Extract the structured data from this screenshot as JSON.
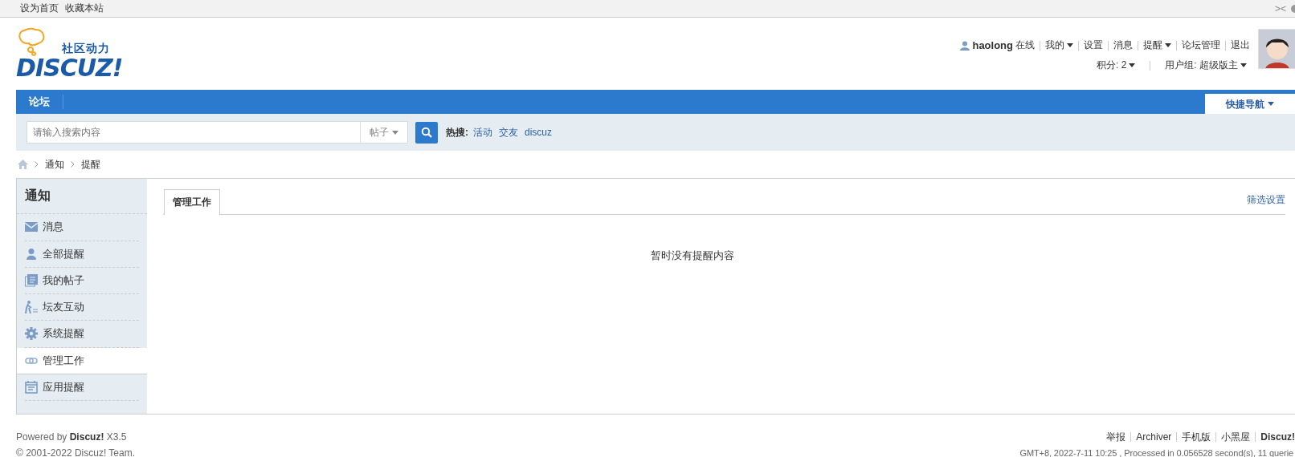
{
  "top_bar": {
    "links": [
      "设为首页",
      "收藏本站"
    ],
    "control": "><"
  },
  "logo": {
    "tagline": "社区动力",
    "brand": "DISCUZ!"
  },
  "user_menu": {
    "username": "haolong",
    "status": "在线",
    "links": [
      {
        "label": "我的",
        "dropdown": true
      },
      {
        "label": "设置",
        "dropdown": false
      },
      {
        "label": "消息",
        "dropdown": false
      },
      {
        "label": "提醒",
        "dropdown": true
      },
      {
        "label": "论坛管理",
        "dropdown": false
      },
      {
        "label": "退出",
        "dropdown": false
      }
    ],
    "info": [
      {
        "label": "积分: 2",
        "dropdown": true
      },
      {
        "label": "用户组: 超级版主",
        "dropdown": true
      }
    ]
  },
  "nav": {
    "items": [
      "论坛"
    ],
    "quick_nav": "快捷导航"
  },
  "search": {
    "placeholder": "请输入搜索内容",
    "type": "帖子",
    "hot_label": "热搜:",
    "hot": [
      "活动",
      "交友",
      "discuz"
    ]
  },
  "breadcrumb": [
    "通知",
    "提醒"
  ],
  "sidebar": {
    "title": "通知",
    "items": [
      {
        "label": "消息",
        "selected": false
      },
      {
        "label": "全部提醒",
        "selected": false
      },
      {
        "label": "我的帖子",
        "selected": false
      },
      {
        "label": "坛友互动",
        "selected": false
      },
      {
        "label": "系统提醒",
        "selected": false
      },
      {
        "label": "管理工作",
        "selected": true
      },
      {
        "label": "应用提醒",
        "selected": false
      }
    ]
  },
  "content": {
    "tabs": [
      {
        "label": "管理工作",
        "selected": true
      }
    ],
    "filter_link": "筛选设置",
    "empty_message": "暂时没有提醒内容"
  },
  "footer": {
    "powered": "Powered by **Discuz!** X3.5",
    "copyright": "© 2001-2022 Discuz! Team.",
    "links": [
      "举报",
      "Archiver",
      "手机版",
      "小黑屋"
    ],
    "brand": "Discuz!",
    "stats": "GMT+8, 2022-7-11 10:25 , Processed in 0.056528 second(s), 11 querie"
  }
}
